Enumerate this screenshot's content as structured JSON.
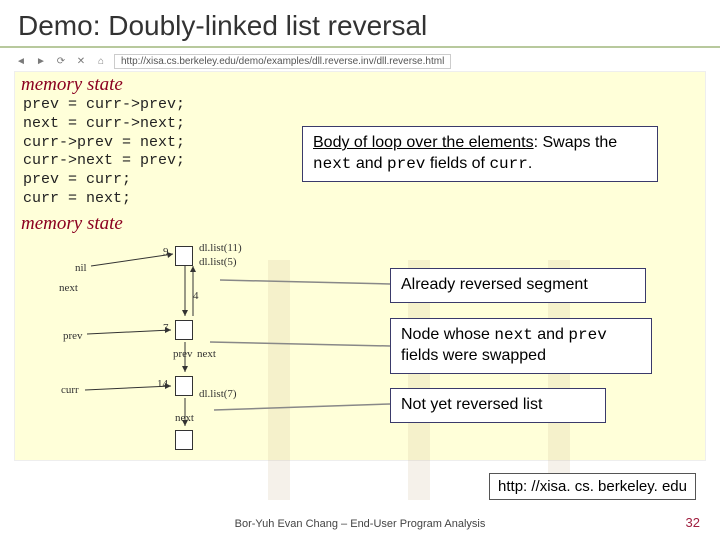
{
  "title": "Demo: Doubly-linked list reversal",
  "browser": {
    "url": "http://xisa.cs.berkeley.edu/demo/examples/dll.reverse.inv/dll.reverse.html"
  },
  "sections": {
    "memstate1": "memory state",
    "memstate2": "memory state"
  },
  "code": "prev = curr->prev;\nnext = curr->next;\ncurr->prev = next;\ncurr->next = prev;\nprev = curr;\ncurr = next;",
  "callouts": {
    "body": {
      "underline": "Body of loop over the elements",
      "rest1": ": Swaps the ",
      "m1": "next",
      "rest2": " and ",
      "m2": "prev",
      "rest3": " fields of ",
      "m3": "curr",
      "rest4": "."
    },
    "c1": "Already reversed segment",
    "c2a": "Node whose ",
    "c2m1": "next",
    "c2b": " and ",
    "c2m2": "prev",
    "c2c": " fields were swapped",
    "c3": "Not yet reversed list"
  },
  "diagram": {
    "nil": "nil",
    "prev": "prev",
    "next": "next",
    "curr": "curr",
    "dlist11": "dl.list(11)",
    "dlist5": "dl.list(5)",
    "dlist7": "dl.list(7)",
    "n9": "9",
    "n4": "4",
    "n7": "7",
    "n14": "14"
  },
  "url_callout": "http: //xisa. cs. berkeley. edu",
  "footer": "Bor-Yuh Evan Chang – End-User Program Analysis",
  "page": "32"
}
